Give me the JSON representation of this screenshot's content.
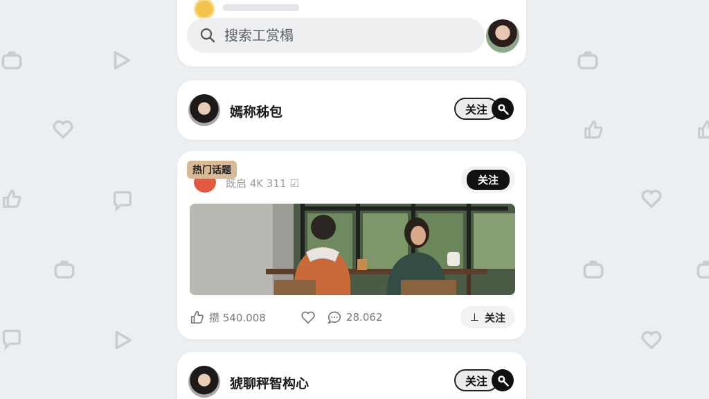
{
  "search": {
    "placeholder": "搜索工赏榻"
  },
  "users": [
    {
      "name": "嫣称秭包",
      "follow_label": "关注"
    },
    {
      "name": "猇聊秤智构心",
      "follow_label": "关注"
    }
  ],
  "post": {
    "tag": "热门话题",
    "meta": "既启 4K 311 ☑",
    "follow_label": "关注",
    "like_count": "攒 540.008",
    "comment_count": "28.062",
    "action_follow_label": "关注",
    "action_follow_icon": "⊥"
  },
  "icons": [
    "search-icon",
    "lens-icon",
    "thumbs-up-icon",
    "heart-icon",
    "comment-icon"
  ],
  "colors": {
    "background": "#eceff1",
    "card": "#ffffff",
    "tag": "#d9b996",
    "follow_dark": "#111111",
    "post_avatar": "#e05a43"
  }
}
